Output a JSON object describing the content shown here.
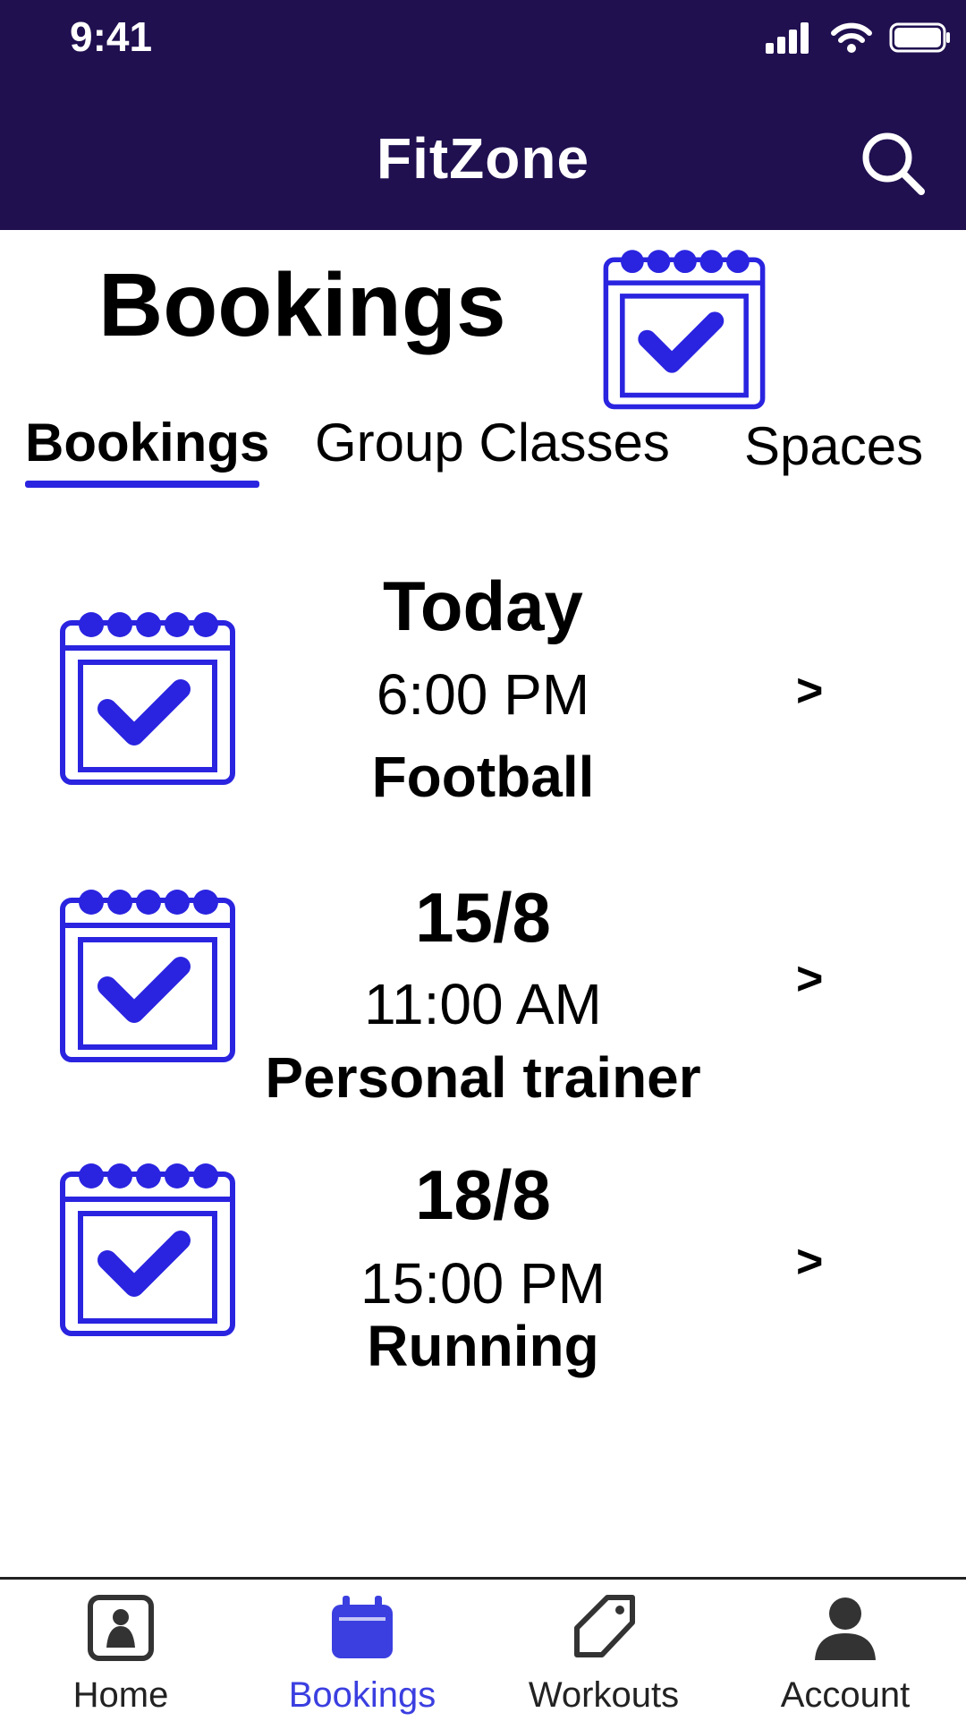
{
  "status_bar": {
    "time": "9:41"
  },
  "header": {
    "app_title": "FitZone"
  },
  "page": {
    "title": "Bookings"
  },
  "tabs": [
    {
      "label": "Bookings",
      "active": true
    },
    {
      "label": "Group Classes",
      "active": false
    },
    {
      "label": "Spaces",
      "active": false
    }
  ],
  "bookings": [
    {
      "date": "Today",
      "time": "6:00 PM",
      "activity": "Football",
      "chevron": ">"
    },
    {
      "date": "15/8",
      "time": "11:00 AM",
      "activity": "Personal trainer",
      "chevron": ">"
    },
    {
      "date": "18/8",
      "time": "15:00 PM",
      "activity": "Running",
      "chevron": ">"
    }
  ],
  "bottom_nav": [
    {
      "label": "Home",
      "icon": "home-icon",
      "active": false
    },
    {
      "label": "Bookings",
      "icon": "calendar-icon",
      "active": true
    },
    {
      "label": "Workouts",
      "icon": "tag-icon",
      "active": false
    },
    {
      "label": "Account",
      "icon": "person-icon",
      "active": false
    }
  ],
  "colors": {
    "header_bg": "#201050",
    "accent": "#2a24e0",
    "nav_active": "#3b3fe0"
  }
}
